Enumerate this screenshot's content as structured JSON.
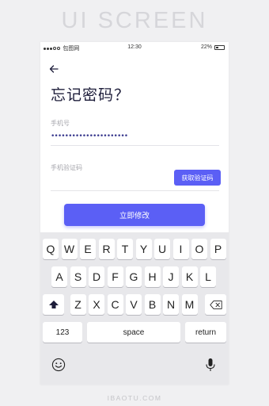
{
  "banner": "UI SCREEN",
  "status": {
    "carrier": "包图网",
    "time": "12:30",
    "battery": "22%"
  },
  "page": {
    "title": "忘记密码？",
    "phone_label": "手机号",
    "phone_value": "••••••••••••••••••••••",
    "code_label": "手机验证码",
    "code_button": "获取验证码",
    "submit": "立即修改"
  },
  "keyboard": {
    "row1": [
      "Q",
      "W",
      "E",
      "R",
      "T",
      "Y",
      "U",
      "I",
      "O",
      "P"
    ],
    "row2": [
      "A",
      "S",
      "D",
      "F",
      "G",
      "H",
      "J",
      "K",
      "L"
    ],
    "row3": [
      "Z",
      "X",
      "C",
      "V",
      "B",
      "N",
      "M"
    ],
    "numbers": "123",
    "space": "space",
    "return": "return"
  },
  "footer": "IBAOTU.COM",
  "colors": {
    "accent": "#5b5ff5",
    "title": "#1d1d3a"
  }
}
